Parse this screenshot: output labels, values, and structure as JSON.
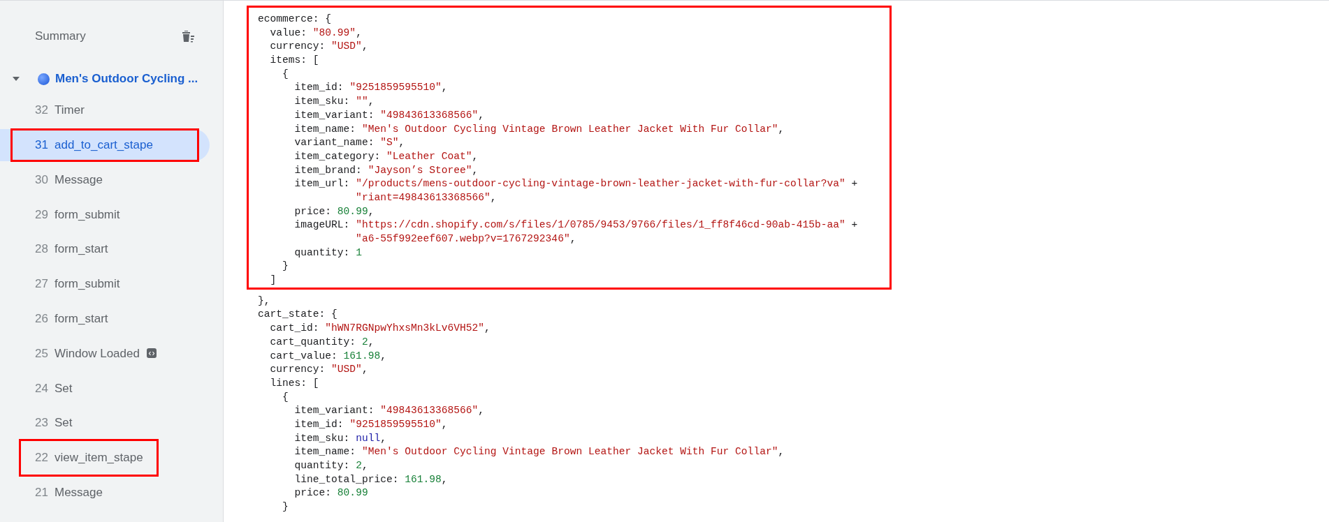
{
  "sidebar": {
    "title": "Summary",
    "group": {
      "title": "Men's Outdoor Cycling ...",
      "expanded": true,
      "items": [
        {
          "number": "32",
          "label": "Timer",
          "selected": false,
          "boxed": false
        },
        {
          "number": "31",
          "label": "add_to_cart_stape",
          "selected": true,
          "boxed": true
        },
        {
          "number": "30",
          "label": "Message",
          "selected": false,
          "boxed": false
        },
        {
          "number": "29",
          "label": "form_submit",
          "selected": false,
          "boxed": false
        },
        {
          "number": "28",
          "label": "form_start",
          "selected": false,
          "boxed": false
        },
        {
          "number": "27",
          "label": "form_submit",
          "selected": false,
          "boxed": false
        },
        {
          "number": "26",
          "label": "form_start",
          "selected": false,
          "boxed": false
        },
        {
          "number": "25",
          "label": "Window Loaded",
          "selected": false,
          "boxed": false,
          "code_badge": true
        },
        {
          "number": "24",
          "label": "Set",
          "selected": false,
          "boxed": false
        },
        {
          "number": "23",
          "label": "Set",
          "selected": false,
          "boxed": false
        },
        {
          "number": "22",
          "label": "view_item_stape",
          "selected": false,
          "boxed": true
        },
        {
          "number": "21",
          "label": "Message",
          "selected": false,
          "boxed": false
        }
      ]
    }
  },
  "code": {
    "sections": [
      {
        "boxed": true,
        "lines": [
          [
            {
              "kind": "plain",
              "text": "ecommerce: {"
            }
          ],
          [
            {
              "kind": "plain",
              "text": "  value: "
            },
            {
              "kind": "string",
              "text": "\"80.99\""
            },
            {
              "kind": "plain",
              "text": ","
            }
          ],
          [
            {
              "kind": "plain",
              "text": "  currency: "
            },
            {
              "kind": "string",
              "text": "\"USD\""
            },
            {
              "kind": "plain",
              "text": ","
            }
          ],
          [
            {
              "kind": "plain",
              "text": "  items: ["
            }
          ],
          [
            {
              "kind": "plain",
              "text": "    {"
            }
          ],
          [
            {
              "kind": "plain",
              "text": "      item_id: "
            },
            {
              "kind": "string",
              "text": "\"9251859595510\""
            },
            {
              "kind": "plain",
              "text": ","
            }
          ],
          [
            {
              "kind": "plain",
              "text": "      item_sku: "
            },
            {
              "kind": "string",
              "text": "\"\""
            },
            {
              "kind": "plain",
              "text": ","
            }
          ],
          [
            {
              "kind": "plain",
              "text": "      item_variant: "
            },
            {
              "kind": "string",
              "text": "\"49843613368566\""
            },
            {
              "kind": "plain",
              "text": ","
            }
          ],
          [
            {
              "kind": "plain",
              "text": "      item_name: "
            },
            {
              "kind": "string",
              "text": "\"Men's Outdoor Cycling Vintage Brown Leather Jacket With Fur Collar\""
            },
            {
              "kind": "plain",
              "text": ","
            }
          ],
          [
            {
              "kind": "plain",
              "text": "      variant_name: "
            },
            {
              "kind": "string",
              "text": "\"S\""
            },
            {
              "kind": "plain",
              "text": ","
            }
          ],
          [
            {
              "kind": "plain",
              "text": "      item_category: "
            },
            {
              "kind": "string",
              "text": "\"Leather Coat\""
            },
            {
              "kind": "plain",
              "text": ","
            }
          ],
          [
            {
              "kind": "plain",
              "text": "      item_brand: "
            },
            {
              "kind": "string",
              "text": "\"Jayson’s Storee\""
            },
            {
              "kind": "plain",
              "text": ","
            }
          ],
          [
            {
              "kind": "plain",
              "text": "      item_url: "
            },
            {
              "kind": "string",
              "text": "\"/products/mens-outdoor-cycling-vintage-brown-leather-jacket-with-fur-collar?va\""
            },
            {
              "kind": "plain",
              "text": " +"
            }
          ],
          [
            {
              "kind": "string",
              "text": "                \"riant=49843613368566\""
            },
            {
              "kind": "plain",
              "text": ","
            }
          ],
          [
            {
              "kind": "plain",
              "text": "      price: "
            },
            {
              "kind": "number",
              "text": "80.99"
            },
            {
              "kind": "plain",
              "text": ","
            }
          ],
          [
            {
              "kind": "plain",
              "text": "      imageURL: "
            },
            {
              "kind": "string",
              "text": "\"https://cdn.shopify.com/s/files/1/0785/9453/9766/files/1_ff8f46cd-90ab-415b-aa\""
            },
            {
              "kind": "plain",
              "text": " +"
            }
          ],
          [
            {
              "kind": "string",
              "text": "                \"a6-55f992eef607.webp?v=1767292346\""
            },
            {
              "kind": "plain",
              "text": ","
            }
          ],
          [
            {
              "kind": "plain",
              "text": "      quantity: "
            },
            {
              "kind": "number",
              "text": "1"
            }
          ],
          [
            {
              "kind": "plain",
              "text": "    }"
            }
          ],
          [
            {
              "kind": "plain",
              "text": "  ]"
            }
          ]
        ]
      },
      {
        "boxed": false,
        "lines": [
          [
            {
              "kind": "plain",
              "text": "},"
            }
          ],
          [
            {
              "kind": "plain",
              "text": "cart_state: {"
            }
          ],
          [
            {
              "kind": "plain",
              "text": "  cart_id: "
            },
            {
              "kind": "string",
              "text": "\"hWN7RGNpwYhxsMn3kLv6VH52\""
            },
            {
              "kind": "plain",
              "text": ","
            }
          ],
          [
            {
              "kind": "plain",
              "text": "  cart_quantity: "
            },
            {
              "kind": "number",
              "text": "2"
            },
            {
              "kind": "plain",
              "text": ","
            }
          ],
          [
            {
              "kind": "plain",
              "text": "  cart_value: "
            },
            {
              "kind": "number",
              "text": "161.98"
            },
            {
              "kind": "plain",
              "text": ","
            }
          ],
          [
            {
              "kind": "plain",
              "text": "  currency: "
            },
            {
              "kind": "string",
              "text": "\"USD\""
            },
            {
              "kind": "plain",
              "text": ","
            }
          ],
          [
            {
              "kind": "plain",
              "text": "  lines: ["
            }
          ],
          [
            {
              "kind": "plain",
              "text": "    {"
            }
          ],
          [
            {
              "kind": "plain",
              "text": "      item_variant: "
            },
            {
              "kind": "string",
              "text": "\"49843613368566\""
            },
            {
              "kind": "plain",
              "text": ","
            }
          ],
          [
            {
              "kind": "plain",
              "text": "      item_id: "
            },
            {
              "kind": "string",
              "text": "\"9251859595510\""
            },
            {
              "kind": "plain",
              "text": ","
            }
          ],
          [
            {
              "kind": "plain",
              "text": "      item_sku: "
            },
            {
              "kind": "null",
              "text": "null"
            },
            {
              "kind": "plain",
              "text": ","
            }
          ],
          [
            {
              "kind": "plain",
              "text": "      item_name: "
            },
            {
              "kind": "string",
              "text": "\"Men's Outdoor Cycling Vintage Brown Leather Jacket With Fur Collar\""
            },
            {
              "kind": "plain",
              "text": ","
            }
          ],
          [
            {
              "kind": "plain",
              "text": "      quantity: "
            },
            {
              "kind": "number",
              "text": "2"
            },
            {
              "kind": "plain",
              "text": ","
            }
          ],
          [
            {
              "kind": "plain",
              "text": "      line_total_price: "
            },
            {
              "kind": "number",
              "text": "161.98"
            },
            {
              "kind": "plain",
              "text": ","
            }
          ],
          [
            {
              "kind": "plain",
              "text": "      price: "
            },
            {
              "kind": "number",
              "text": "80.99"
            }
          ],
          [
            {
              "kind": "plain",
              "text": "    }"
            }
          ]
        ]
      }
    ]
  }
}
